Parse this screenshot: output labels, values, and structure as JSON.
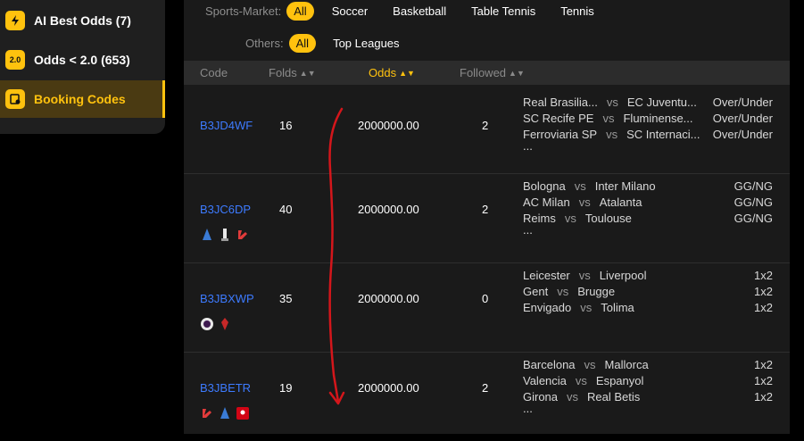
{
  "sidebar": {
    "items": [
      {
        "label": "AI Best Odds (7)",
        "icon": "lightning-icon",
        "active": false
      },
      {
        "label": "Odds < 2.0 (653)",
        "icon": "odds-badge-icon",
        "badge_text": "2.0",
        "active": false
      },
      {
        "label": "Booking Codes",
        "icon": "booking-codes-icon",
        "active": true
      }
    ]
  },
  "filters": {
    "sports_label": "Sports-Market:",
    "sports_all": "All",
    "sports_options": [
      "Soccer",
      "Basketball",
      "Table Tennis",
      "Tennis"
    ],
    "others_label": "Others:",
    "others_all": "All",
    "others_options": [
      "Top Leagues"
    ]
  },
  "table": {
    "headers": {
      "code": "Code",
      "folds": "Folds",
      "odds": "Odds",
      "followed": "Followed"
    },
    "rows": [
      {
        "code": "B3JD4WF",
        "folds": "16",
        "odds": "2000000.00",
        "followed": "2",
        "badges": [],
        "matches": [
          {
            "home": "Real Brasilia...",
            "away": "EC Juventu...",
            "market": "Over/Under"
          },
          {
            "home": "SC Recife PE",
            "away": "Fluminense...",
            "market": "Over/Under"
          },
          {
            "home": "Ferroviaria SP",
            "away": "SC Internaci...",
            "market": "Over/Under"
          }
        ]
      },
      {
        "code": "B3JC6DP",
        "folds": "40",
        "odds": "2000000.00",
        "followed": "2",
        "badges": [
          "serie-a-logo-icon",
          "ligue-1-logo-icon",
          "laliga-logo-icon"
        ],
        "matches": [
          {
            "home": "Bologna",
            "away": "Inter Milano",
            "market": "GG/NG"
          },
          {
            "home": "AC Milan",
            "away": "Atalanta",
            "market": "GG/NG"
          },
          {
            "home": "Reims",
            "away": "Toulouse",
            "market": "GG/NG"
          }
        ]
      },
      {
        "code": "B3JBXWP",
        "folds": "35",
        "odds": "2000000.00",
        "followed": "0",
        "badges": [
          "premier-league-logo-icon",
          "liga-betplay-logo-icon"
        ],
        "matches": [
          {
            "home": "Leicester",
            "away": "Liverpool",
            "market": "1x2"
          },
          {
            "home": "Gent",
            "away": "Brugge",
            "market": "1x2"
          },
          {
            "home": "Envigado",
            "away": "Tolima",
            "market": "1x2"
          }
        ]
      },
      {
        "code": "B3JBETR",
        "folds": "19",
        "odds": "2000000.00",
        "followed": "2",
        "badges": [
          "laliga-logo-icon",
          "serie-a-logo-icon",
          "bundesliga-logo-icon"
        ],
        "matches": [
          {
            "home": "Barcelona",
            "away": "Mallorca",
            "market": "1x2"
          },
          {
            "home": "Valencia",
            "away": "Espanyol",
            "market": "1x2"
          },
          {
            "home": "Girona",
            "away": "Real Betis",
            "market": "1x2"
          }
        ]
      }
    ],
    "vs": "vs",
    "more": "..."
  },
  "colors": {
    "accent": "#ffc20e",
    "link": "#3d7bff",
    "annotation": "#d4161b"
  }
}
